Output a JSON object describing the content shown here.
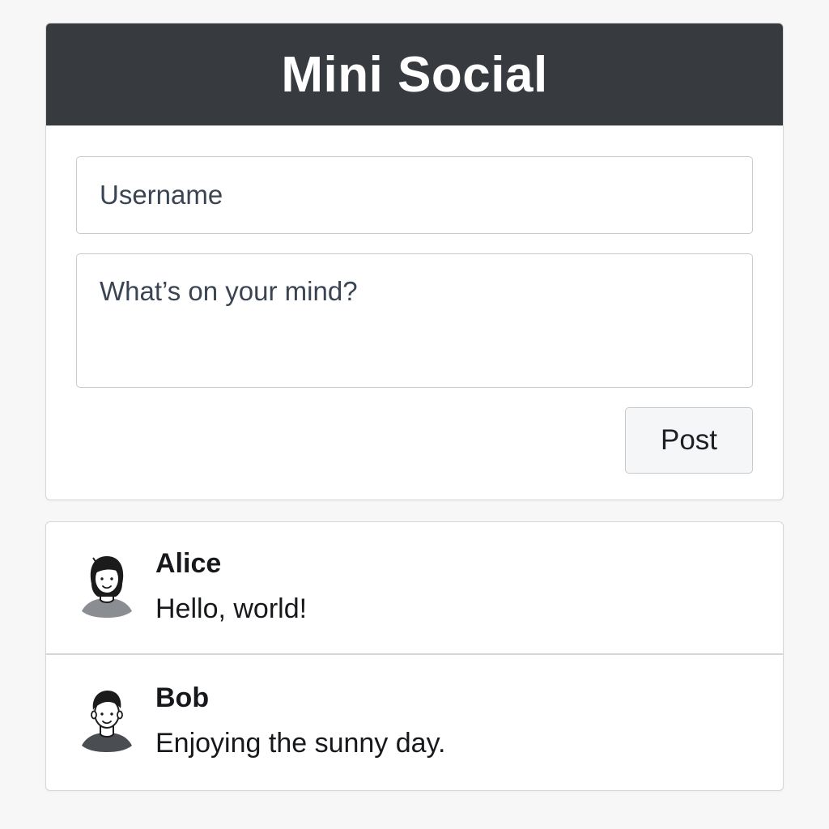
{
  "app": {
    "title": "Mini Social"
  },
  "composer": {
    "username_placeholder": "Username",
    "username_value": "",
    "message_placeholder": "What’s on your mind?",
    "message_value": "",
    "post_label": "Post"
  },
  "posts": [
    {
      "author": "Alice",
      "text": "Hello, world!",
      "avatar_icon": "woman-avatar-icon"
    },
    {
      "author": "Bob",
      "text": "Enjoying the sunny day.",
      "avatar_icon": "man-avatar-icon"
    }
  ],
  "colors": {
    "header_bg": "#373b40",
    "header_text": "#ffffff",
    "page_bg": "#f7f7f7",
    "border": "#c9c9c9"
  }
}
